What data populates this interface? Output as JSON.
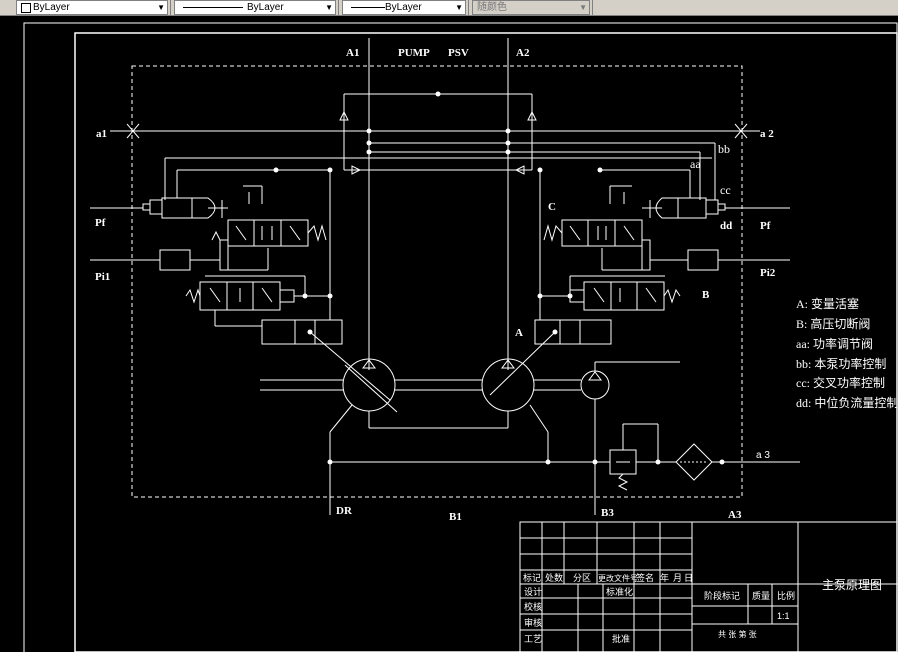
{
  "toolbar": {
    "color_combo": "ByLayer",
    "linetype_combo": "ByLayer",
    "lineweight_combo": "ByLayer",
    "plotstyle_combo": "随颜色"
  },
  "drawing": {
    "ports": {
      "a1": "A1",
      "pump": "PUMP",
      "psv": "PSV",
      "a2": "A2",
      "left_a1": "a1",
      "right_a2": "a 2",
      "bb": "bb",
      "aa": "aa",
      "cc": "cc",
      "dd": "dd",
      "c": "C",
      "b": "B",
      "a": "A",
      "pf_left": "Pf",
      "pf_right": "Pf",
      "pi1": "Pi1",
      "pi2": "Pi2",
      "a3_small": "a 3",
      "dr": "DR",
      "b1": "B1",
      "b3": "B3",
      "a3": "A3"
    },
    "legend": [
      "A: 变量活塞",
      "B: 高压切断阀",
      "aa: 功率调节阀",
      "bb: 本泵功率控制",
      "cc: 交叉功率控制",
      "dd: 中位负流量控制"
    ]
  },
  "title_block": {
    "header_row": [
      "标记",
      "处数",
      "分区",
      "更改文件号",
      "签名",
      "年",
      "月",
      "日"
    ],
    "design": "设计",
    "standardize": "标准化",
    "check": "校核",
    "review": "审核",
    "process": "工艺",
    "approve": "批准",
    "stage_mark": "阶段标记",
    "weight": "质量",
    "scale": "比例",
    "scale_value": "1:1",
    "sheets": "共 张 第 张",
    "drawing_title": "主泵原理图"
  }
}
